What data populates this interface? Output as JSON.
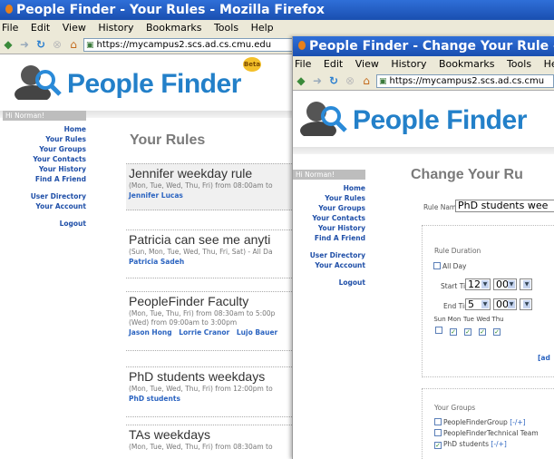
{
  "windows": {
    "rules": {
      "title": "People Finder - Your Rules - Mozilla Firefox",
      "menu": [
        "File",
        "Edit",
        "View",
        "History",
        "Bookmarks",
        "Tools",
        "Help"
      ],
      "url": "https://mycampus2.scs.ad.cs.cmu.edu",
      "logo_text": "People Finder",
      "beta_label": "Beta",
      "greeting": "Hi Norman!",
      "nav": [
        "Home",
        "Your Rules",
        "Your Groups",
        "Your Contacts",
        "Your History",
        "Find A Friend"
      ],
      "nav2": [
        "User Directory",
        "Your Account"
      ],
      "logout": "Logout",
      "page_title": "Your Rules",
      "rules": [
        {
          "name": "Jennifer weekday rule",
          "desc": "(Mon, Tue, Wed, Thu, Fri) from 08:00am to",
          "desc2": "",
          "people": [
            "Jennifer Lucas"
          ]
        },
        {
          "name": "Patricia can see me anyti",
          "desc": "(Sun, Mon, Tue, Wed, Thu, Fri, Sat) - All Da",
          "desc2": "",
          "people": [
            "Patricia Sadeh"
          ]
        },
        {
          "name": "PeopleFinder Faculty",
          "desc": "(Mon, Tue, Thu, Fri) from 08:30am to 5:00p",
          "desc2": "(Wed) from 09:00am to 3:00pm",
          "people": [
            "Jason Hong",
            "Lorrie Cranor",
            "Lujo Bauer"
          ]
        },
        {
          "name": "PhD students weekdays",
          "desc": "(Mon, Tue, Wed, Thu, Fri) from 12:00pm to",
          "desc2": "",
          "people": [
            "PhD students"
          ]
        },
        {
          "name": "TAs weekdays",
          "desc": "(Mon, Tue, Wed, Thu, Fri) from 08:30am to",
          "desc2": "",
          "people": []
        }
      ]
    },
    "change": {
      "title": "People Finder - Change Your Rule - Mozi",
      "menu": [
        "File",
        "Edit",
        "View",
        "History",
        "Bookmarks",
        "Tools",
        "Help"
      ],
      "url": "https://mycampus2.scs.ad.cs.cmu",
      "logo_text": "People Finder",
      "greeting": "Hi Norman!",
      "nav": [
        "Home",
        "Your Rules",
        "Your Groups",
        "Your Contacts",
        "Your History",
        "Find A Friend"
      ],
      "nav2": [
        "User Directory",
        "Your Account"
      ],
      "logout": "Logout",
      "page_title": "Change Your Ru",
      "rule_name_label": "Rule Name",
      "rule_name_value": "PhD students wee",
      "duration_title": "Rule Duration",
      "all_day_label": "All Day",
      "start_label": "Start Time",
      "start_hour": "12",
      "start_min": "00",
      "end_label": "End Time",
      "end_hour": "5",
      "end_min": "00",
      "days": [
        "Sun",
        "Mon",
        "Tue",
        "Wed",
        "Thu"
      ],
      "days_checked": [
        false,
        true,
        true,
        true,
        true
      ],
      "advanced_link": "[ad",
      "groups_title": "Your Groups",
      "groups": [
        {
          "name": "PeopleFinderGroup",
          "link": "[-/+]",
          "checked": false
        },
        {
          "name": "PeopleFinderTechnical Team",
          "link": "",
          "checked": false
        },
        {
          "name": "PhD students",
          "link": "[-/+]",
          "checked": true
        }
      ]
    }
  }
}
